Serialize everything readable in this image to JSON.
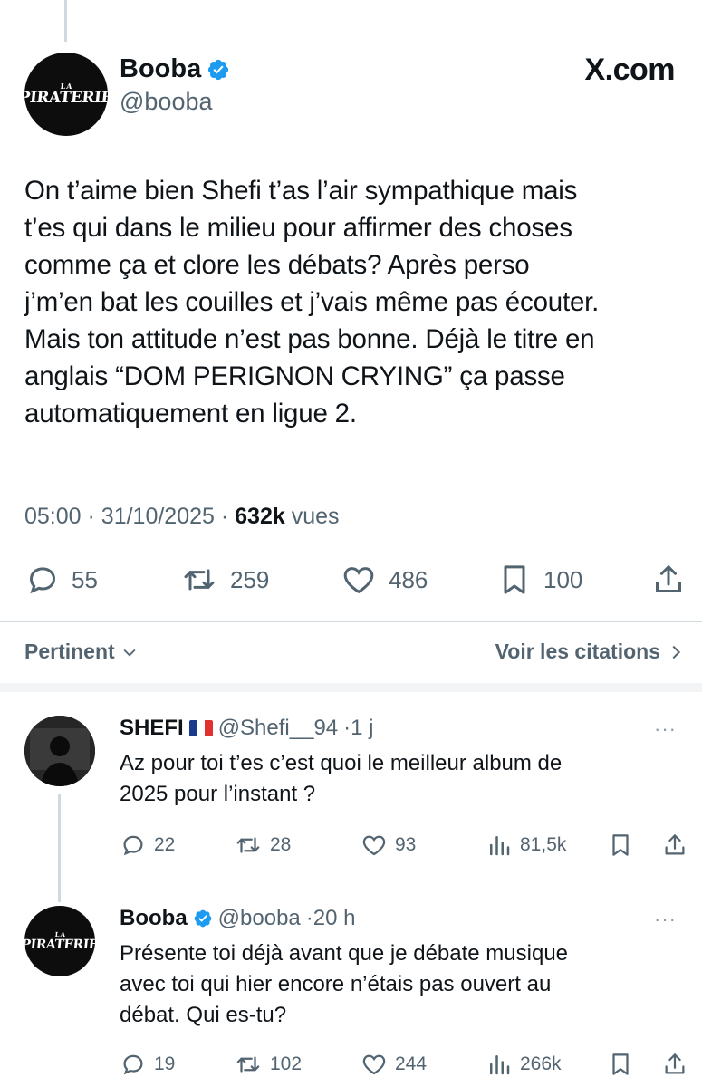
{
  "source": {
    "label": "X.com"
  },
  "main_tweet": {
    "author_name": "Booba",
    "author_handle": "@booba",
    "avatar_logo_small": "LA",
    "avatar_logo_main": "PIRATERIE",
    "text_lines": [
      "On t’aime bien Shefi t’as l’air sympathique mais",
      "t’es qui dans le milieu pour affirmer des choses",
      "comme ça et clore les débats? Après perso",
      "j’m’en bat les couilles et j’vais même pas écouter.",
      "Mais ton attitude n’est pas bonne. Déjà le titre en",
      "anglais “DOM PERIGNON CRYING” ça passe",
      "automatiquement en ligue 2."
    ],
    "time": "05:00",
    "separator": "·",
    "date": "31/10/2025",
    "views_count": "632k",
    "views_label": "vues",
    "replies": "55",
    "reposts": "259",
    "likes": "486",
    "bookmarks": "100"
  },
  "sort": {
    "left_label": "Pertinent",
    "right_label": "Voir les citations"
  },
  "replies": [
    {
      "name": "SHEFI",
      "handle": "@Shefi__94",
      "time": "·1 j",
      "more": "···",
      "text_lines": [
        "Az pour toi t’es c’est quoi le meilleur album de",
        "2025 pour l’instant ?"
      ],
      "replies": "22",
      "reposts": "28",
      "likes": "93",
      "views": "81,5k"
    },
    {
      "name": "Booba",
      "handle": "@booba",
      "time": "·20 h",
      "more": "···",
      "text_lines": [
        "Présente toi déjà avant que je débate musique",
        "avec toi qui hier encore n’étais pas ouvert au",
        "débat. Qui es-tu?"
      ],
      "replies": "19",
      "reposts": "102",
      "likes": "244",
      "views": "266k"
    }
  ],
  "colors": {
    "text": "#0f1419",
    "secondary": "#536471",
    "verified": "#1d9bf0",
    "divider": "#cfd9de",
    "flag_blue": "#1a3a8f",
    "flag_white": "#ffffff",
    "flag_red": "#e1302f"
  },
  "icons": [
    "reply-icon",
    "repost-icon",
    "like-icon",
    "bookmark-icon",
    "share-icon",
    "views-icon",
    "verified-icon",
    "chevron-down-icon",
    "chevron-right-icon"
  ]
}
